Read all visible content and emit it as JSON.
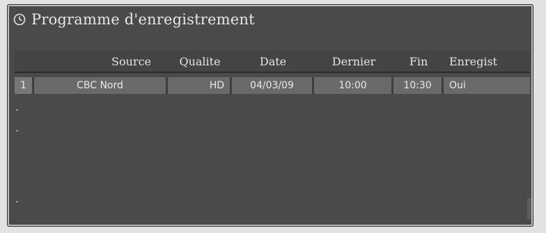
{
  "window": {
    "title": "Programme d'enregistrement",
    "icon": "clock-icon"
  },
  "table": {
    "columns": [
      "",
      "Source",
      "Qualite",
      "Date",
      "Dernier",
      "Fin",
      "Enregist"
    ],
    "rows": [
      {
        "num": "1",
        "source": "CBC Nord",
        "qualite": "HD",
        "date": "04/03/09",
        "dernier": "10:00",
        "fin": "10:30",
        "enregist": "Oui"
      }
    ]
  },
  "colors": {
    "panel_bg": "#4a4a4a",
    "header_bg": "#444444",
    "row_bg": "#6a6a6a",
    "text": "#e8e8e8"
  }
}
